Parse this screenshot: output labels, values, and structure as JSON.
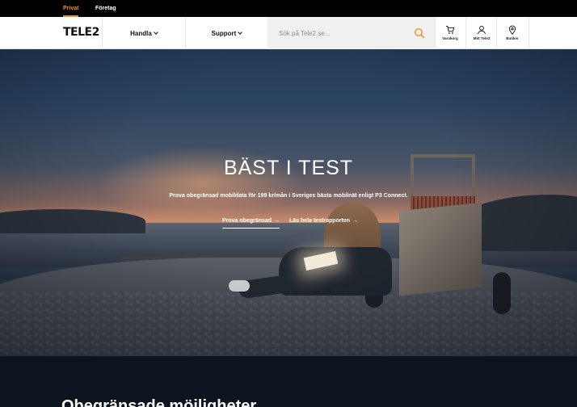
{
  "topbar": {
    "segments": [
      {
        "label": "Privat",
        "active": true
      },
      {
        "label": "Företag",
        "active": false
      }
    ]
  },
  "header": {
    "logo": "TELE2",
    "nav": [
      {
        "label": "Handla"
      },
      {
        "label": "Support"
      }
    ],
    "search": {
      "placeholder": "Sök på Tele2.se..."
    },
    "utilities": [
      {
        "label": "Varukorg",
        "icon": "cart-icon"
      },
      {
        "label": "Mitt Tele2",
        "icon": "user-icon"
      },
      {
        "label": "Butiker",
        "icon": "location-pin-icon"
      }
    ]
  },
  "hero": {
    "title": "BÄST I TEST",
    "subtitle": "Prova obegränsad mobildata för 199 kr/mån i Sveriges bästa mobilnät enligt P3 Connect.",
    "links": [
      {
        "label": "Prova obegränsad",
        "icon": "arrow-right-icon"
      },
      {
        "label": "Läs hela testrapporten",
        "icon": "arrow-right-icon"
      }
    ]
  },
  "section": {
    "title": "Obegränsade möjligheter"
  },
  "colors": {
    "accent": "#f28c28",
    "topbar_bg": "#000000",
    "page_dark": "#0c1420"
  }
}
